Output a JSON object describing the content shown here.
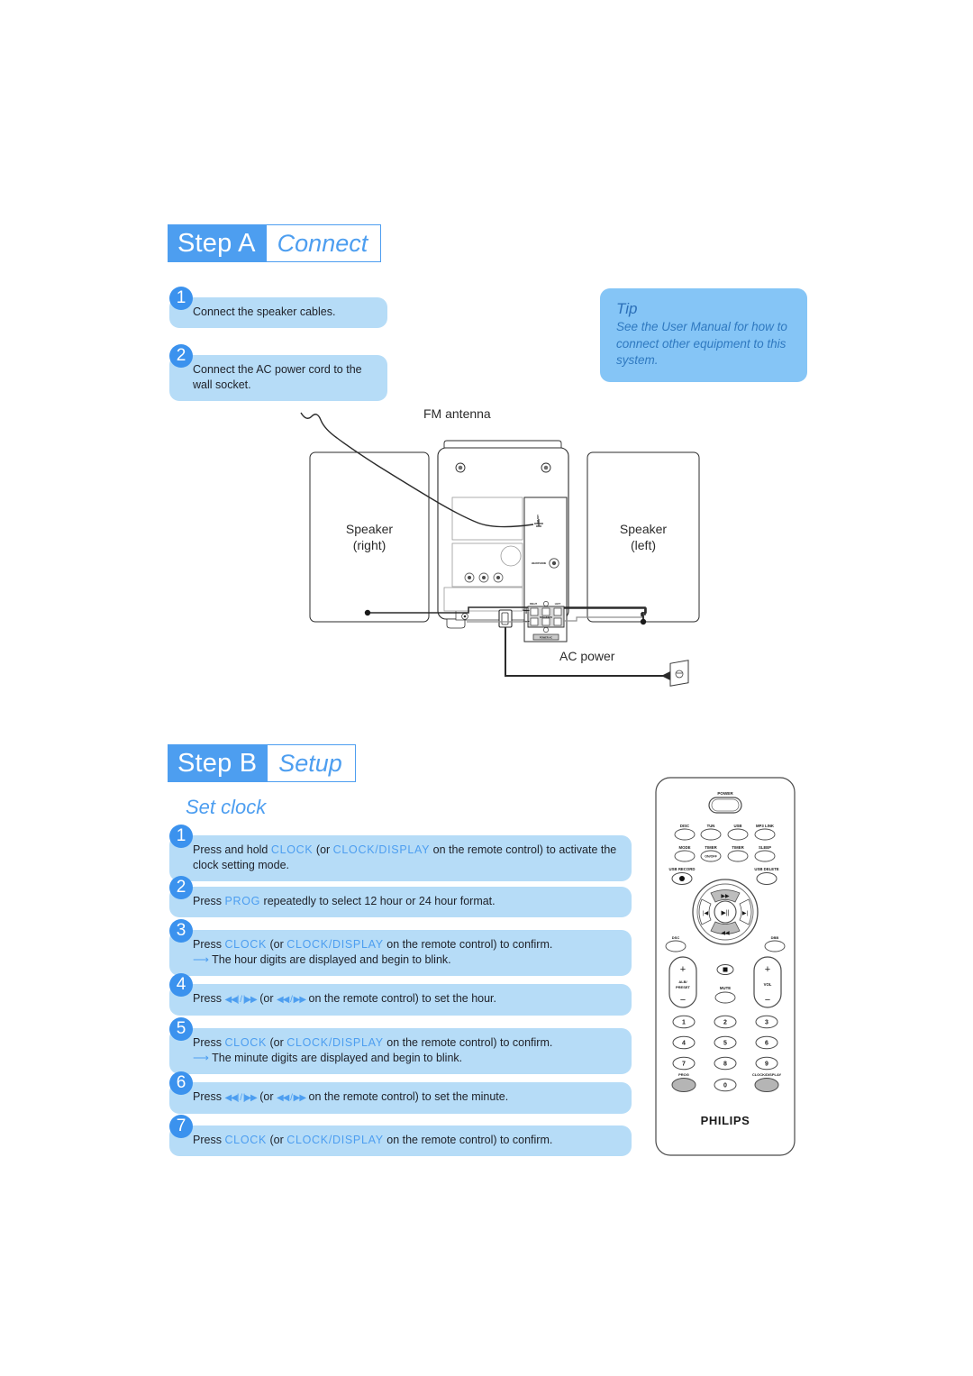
{
  "steps": [
    {
      "id": "step-a",
      "label": "Step A",
      "name": "Connect",
      "items": [
        {
          "num": "1",
          "text": "Connect the speaker cables."
        },
        {
          "num": "2",
          "text": "Connect the AC power cord to the wall socket."
        }
      ]
    },
    {
      "id": "step-b",
      "label": "Step B",
      "name": "Setup",
      "subtitle": "Set clock"
    }
  ],
  "tip": {
    "title": "Tip",
    "text": "See the User Manual for how to connect other equipment to this system."
  },
  "clock_steps": [
    {
      "num": "1",
      "line1_a": "Press and hold ",
      "kw1": "CLOCK",
      "line1_b": " (or ",
      "kw2": "CLOCK/DISPLAY",
      "line1_c": " on the remote control) to activate the clock setting mode.",
      "result": ""
    },
    {
      "num": "2",
      "line1_a": "Press ",
      "kw1": "PROG",
      "line1_b": " repeatedly to select 12 hour or 24 hour format.",
      "kw2": "",
      "line1_c": "",
      "result": ""
    },
    {
      "num": "3",
      "line1_a": "Press ",
      "kw1": "CLOCK",
      "line1_b": " (or ",
      "kw2": "CLOCK/DISPLAY",
      "line1_c": " on the remote control) to confirm.",
      "result": "The hour digits are displayed and begin to blink."
    },
    {
      "num": "4",
      "line1_a": "Press ",
      "kw1": "",
      "line1_b": "",
      "kw2": "",
      "line1_c": " on the remote control) to set the hour.",
      "glyph_a": "◀◀| / |▶▶",
      "glyph_mid": " (or ",
      "glyph_b": "◀◀ / ▶▶",
      "result": ""
    },
    {
      "num": "5",
      "line1_a": "Press ",
      "kw1": "CLOCK",
      "line1_b": " (or ",
      "kw2": "CLOCK/DISPLAY",
      "line1_c": " on the remote control) to confirm.",
      "result": "The minute digits are displayed and begin to blink."
    },
    {
      "num": "6",
      "line1_a": "Press ",
      "kw1": "",
      "line1_b": "",
      "kw2": "",
      "line1_c": " on the remote control) to set the minute.",
      "glyph_a": "◀◀| / |▶▶",
      "glyph_mid": " (or ",
      "glyph_b": "◀◀ / ▶▶",
      "result": ""
    },
    {
      "num": "7",
      "line1_a": "Press ",
      "kw1": "CLOCK",
      "line1_b": " (or ",
      "kw2": "CLOCK/DISPLAY",
      "line1_c": " on the remote control) to confirm.",
      "result": ""
    }
  ],
  "diagram": {
    "fm_antenna_label": "FM antenna",
    "speaker_right_line1": "Speaker",
    "speaker_right_line2": "(right)",
    "speaker_left_line1": "Speaker",
    "speaker_left_line2": "(left)",
    "ac_power_label": "AC power",
    "panel": {
      "fm_jack": "FM ANT",
      "headphone_jack": "HEADPHONE",
      "right_terminal": "RIGHT",
      "left_terminal": "LEFT",
      "speakers_label": "SPEAKERS",
      "power_label": "POWER AC",
      "plus": "+",
      "minus": "−"
    }
  },
  "remote": {
    "brand": "PHILIPS",
    "power": "POWER",
    "source_row": [
      "DISC",
      "TUN",
      "USB",
      "MP3 LINK"
    ],
    "mode_row": [
      "MODE",
      "TIMER",
      "TIMER",
      "SLEEP"
    ],
    "timer_onoff": "ON/OFF",
    "usb_record": "USB RECORD",
    "usb_delete": "USB DELETE",
    "nav": {
      "up": "▶▶",
      "down": "◀◀",
      "left": "|◀",
      "right": "▶|",
      "center": "▶||"
    },
    "dsc": "DSC",
    "dbb": "DBB",
    "alb_preset_line1": "ALB/",
    "alb_preset_line2": "PRESET",
    "vol": "VOL",
    "mute": "MUTE",
    "plus": "+",
    "minus": "−",
    "stop": "■",
    "numbers": [
      "1",
      "2",
      "3",
      "4",
      "5",
      "6",
      "7",
      "8",
      "9",
      "0"
    ],
    "prog": "PROG",
    "clock_display": "CLOCK/DISPLAY"
  },
  "colors": {
    "brand_blue": "#4d9ef0",
    "light_blue": "#b6dcf7",
    "tip_blue": "#85c5f6",
    "num_blue": "#3b92ee"
  }
}
